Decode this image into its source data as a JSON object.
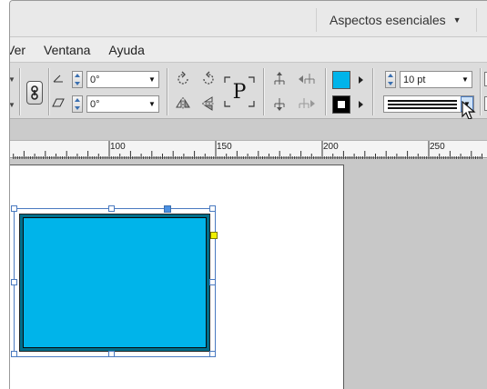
{
  "workspace": {
    "label": "Aspectos esenciales"
  },
  "menubar": {
    "items": [
      "Ver",
      "Ventana",
      "Ayuda"
    ]
  },
  "control": {
    "angle_rotate": "0°",
    "angle_shear": "0°",
    "stroke_weight": "10 pt",
    "text_frame_glyph": "P"
  },
  "ruler": {
    "labels": [
      "100",
      "150",
      "200",
      "250"
    ]
  },
  "colors": {
    "fill": "#00b4ea",
    "stroke": "#000000",
    "selection": "#4a7ac0",
    "accent_handle": "#f0f000"
  }
}
